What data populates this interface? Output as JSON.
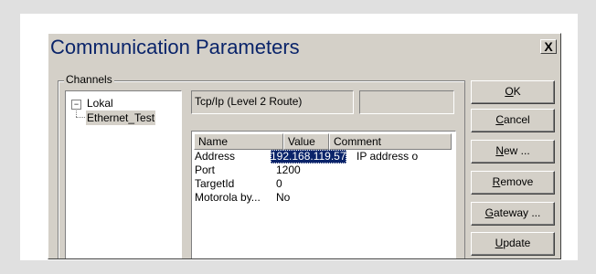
{
  "dialog": {
    "title": "Communication Parameters",
    "close_label": "X"
  },
  "channels": {
    "group_label": "Channels",
    "tree": {
      "root": "Lokal",
      "expander": "−",
      "child": "Ethernet_Test"
    }
  },
  "protocol": {
    "value": "Tcp/Ip (Level 2 Route)",
    "extra_value": ""
  },
  "parameters": {
    "headers": [
      "Name",
      "Value",
      "Comment"
    ],
    "rows": [
      {
        "name": "Address",
        "value": "192.168.119.57",
        "comment": "IP address o"
      },
      {
        "name": "Port",
        "value": "1200",
        "comment": ""
      },
      {
        "name": "TargetId",
        "value": "0",
        "comment": ""
      },
      {
        "name": "Motorola by...",
        "value": "No",
        "comment": ""
      }
    ]
  },
  "buttons": [
    {
      "underline": "O",
      "rest": "K"
    },
    {
      "underline": "C",
      "rest": "ancel"
    },
    {
      "underline": "N",
      "rest": "ew ..."
    },
    {
      "underline": "R",
      "rest": "emove"
    },
    {
      "underline": "G",
      "rest": "ateway ..."
    },
    {
      "underline": "U",
      "rest": "pdate"
    }
  ],
  "colors": {
    "face": "#d4d0c8",
    "title_text": "#0a246a",
    "selection": "#0a246a"
  }
}
